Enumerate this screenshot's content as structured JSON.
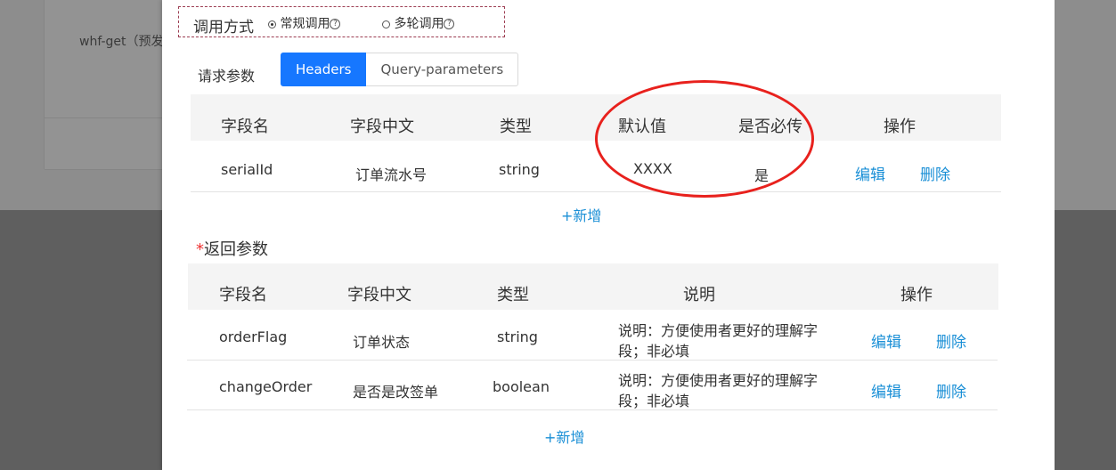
{
  "background": {
    "api_name_text": "whf-get（预发"
  },
  "call_mode": {
    "label": "调用方式",
    "options": [
      {
        "label": "常规调用",
        "selected": true
      },
      {
        "label": "多轮调用",
        "selected": false
      }
    ],
    "help_glyph": "?"
  },
  "request": {
    "label": "请求参数",
    "tabs": [
      {
        "label": "Headers",
        "active": true
      },
      {
        "label": "Query-parameters",
        "active": false
      }
    ],
    "columns": [
      "字段名",
      "字段中文",
      "类型",
      "默认值",
      "是否必传",
      "操作"
    ],
    "rows": [
      {
        "field": "serialId",
        "chinese": "订单流水号",
        "type": "string",
        "default": "XXXX",
        "required": "是",
        "edit": "编辑",
        "delete": "删除"
      }
    ],
    "add_label": "+新增"
  },
  "response": {
    "required_mark": "*",
    "label": "返回参数",
    "columns": [
      "字段名",
      "字段中文",
      "类型",
      "说明",
      "操作"
    ],
    "rows": [
      {
        "field": "orderFlag",
        "chinese": "订单状态",
        "type": "string",
        "desc": "说明：方便使用者更好的理解字段；非必填",
        "edit": "编辑",
        "delete": "删除"
      },
      {
        "field": "changeOrder",
        "chinese": "是否是改签单",
        "type": "boolean",
        "desc": "说明：方便使用者更好的理解字段；非必填",
        "edit": "编辑",
        "delete": "删除"
      }
    ],
    "add_label": "+新增"
  },
  "colors": {
    "accent": "#1677ff",
    "link": "#1a8fd6",
    "annotation": "#e8211d"
  }
}
